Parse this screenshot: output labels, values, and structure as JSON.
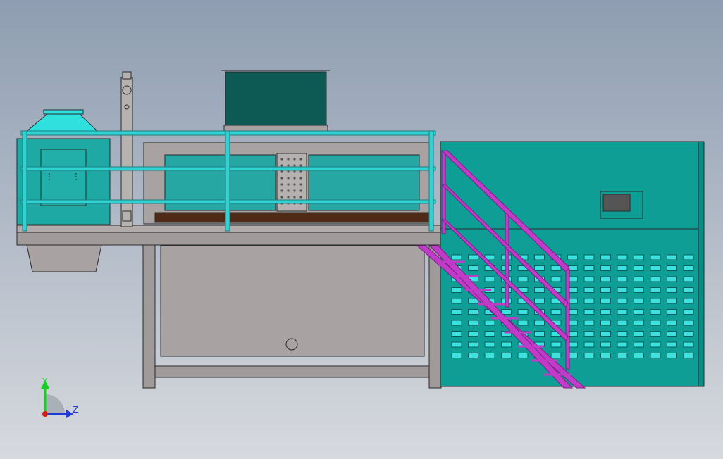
{
  "viewport": {
    "background_top": "#8E9DB1",
    "background_bottom": "#D6D9DE"
  },
  "colors": {
    "outline": "#2A2A2A",
    "frame_gray": "#A09B9A",
    "frame_dark": "#8C8785",
    "teal_panel": "#0F9E96",
    "teal_light": "#27A7A4",
    "cyan_rail": "#30D2D2",
    "cyan_hood": "#2FE0DF",
    "dark_teal_box": "#0D5A55",
    "brown_tray": "#4E2A17",
    "magenta_stair": "#C03BC8",
    "vent_slot": "#3BE2E0",
    "axis_y": "#1ECA2B",
    "axis_z": "#1D39D6",
    "axis_origin": "#D21E1E"
  },
  "triad": {
    "y_label": "Y",
    "z_label": "Z"
  }
}
